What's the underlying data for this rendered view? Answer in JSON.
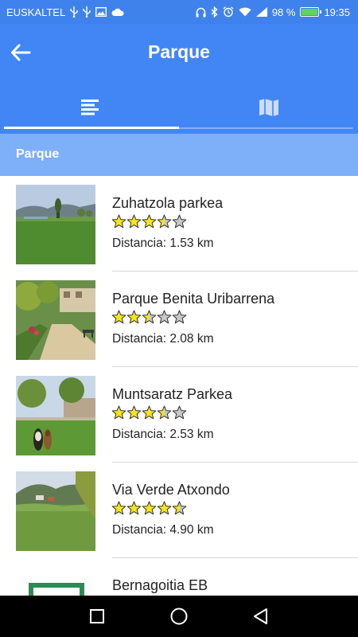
{
  "status_bar": {
    "carrier": "EUSKALTEL",
    "battery_percent": "98 %",
    "time": "19:35",
    "left_icons": [
      "usb-icon",
      "usb-icon",
      "image-icon",
      "cloud-icon"
    ],
    "right_icons": [
      "headphones-icon",
      "bluetooth-icon",
      "alarm-icon",
      "wifi-icon",
      "signal-icon",
      "battery-icon"
    ]
  },
  "app_bar": {
    "title": "Parque",
    "back_icon": "arrow-back-icon"
  },
  "tabs": [
    {
      "icon": "list-icon",
      "selected": true
    },
    {
      "icon": "map-icon",
      "selected": false
    }
  ],
  "section": {
    "title": "Parque"
  },
  "places": [
    {
      "name": "Zuhatzola parkea",
      "rating": 3.5,
      "distance": "Distancia: 1.53 km",
      "image": "meadow-hills"
    },
    {
      "name": "Parque Benita Uribarrena",
      "rating": 2.5,
      "distance": "Distancia: 2.08 km",
      "image": "park-path"
    },
    {
      "name": "Muntsaratz Parkea",
      "rating": 3.5,
      "distance": "Distancia: 2.53 km",
      "image": "dog-park"
    },
    {
      "name": "Via Verde Atxondo",
      "rating": 4.5,
      "distance": "Distancia: 4.90 km",
      "image": "valley-path"
    },
    {
      "name": "Bernagoitia EB",
      "rating": 0,
      "distance": "",
      "image": "sign"
    }
  ],
  "colors": {
    "primary": "#4286f5",
    "status_bar": "#3f82ec",
    "section_header": "#7eaff9",
    "star_fill": "#f5e51b",
    "star_empty": "#c8c8c8",
    "star_stroke": "#333333"
  },
  "nav_bar": {
    "icons": [
      "recents-square-icon",
      "home-circle-icon",
      "back-triangle-icon"
    ]
  }
}
